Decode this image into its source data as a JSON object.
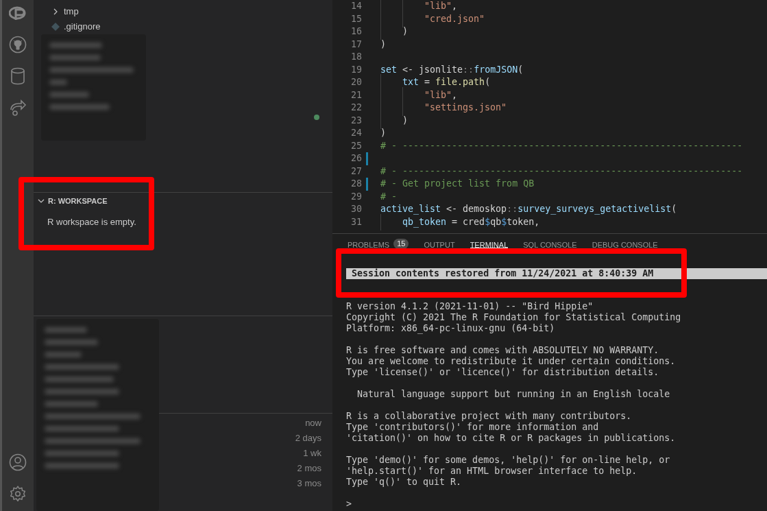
{
  "explorer": {
    "items": [
      {
        "kind": "folder",
        "name": "tmp",
        "expanded": false
      },
      {
        "kind": "file",
        "name": ".gitignore"
      }
    ]
  },
  "workspace": {
    "title": "R: WORKSPACE",
    "expanded": true,
    "message": "R workspace is empty."
  },
  "timeline": {
    "times": [
      "now",
      "2 days",
      "1 wk",
      "2 mos",
      "3 mos"
    ]
  },
  "editor": {
    "lines": [
      {
        "number": "14",
        "modified": false,
        "tokens": [
          {
            "text": "        \"lib\"",
            "kind": "string"
          },
          {
            "text": ",",
            "kind": "plain"
          }
        ]
      },
      {
        "number": "15",
        "modified": false,
        "tokens": [
          {
            "text": "        \"cred.json\"",
            "kind": "string"
          }
        ]
      },
      {
        "number": "16",
        "modified": false,
        "tokens": [
          {
            "text": "    )",
            "kind": "plain"
          }
        ]
      },
      {
        "number": "17",
        "modified": false,
        "tokens": [
          {
            "text": ")",
            "kind": "plain"
          }
        ]
      },
      {
        "number": "18",
        "modified": false
      },
      {
        "number": "19",
        "modified": false,
        "tokens": [
          {
            "text": "set",
            "kind": "var"
          },
          {
            "text": " <- jsonlite",
            "kind": "plain"
          },
          {
            "text": "::",
            "kind": "op"
          },
          {
            "text": "fromJSON",
            "kind": "call"
          },
          {
            "text": "(",
            "kind": "plain"
          }
        ]
      },
      {
        "number": "20",
        "modified": false,
        "tokens": [
          {
            "text": "    txt",
            "kind": "var"
          },
          {
            "text": " = ",
            "kind": "plain"
          },
          {
            "text": "file.path",
            "kind": "func"
          },
          {
            "text": "(",
            "kind": "plain"
          }
        ]
      },
      {
        "number": "21",
        "modified": false,
        "tokens": [
          {
            "text": "        \"lib\"",
            "kind": "string"
          },
          {
            "text": ",",
            "kind": "plain"
          }
        ]
      },
      {
        "number": "22",
        "modified": false,
        "tokens": [
          {
            "text": "        \"settings.json\"",
            "kind": "string"
          }
        ]
      },
      {
        "number": "23",
        "modified": false,
        "tokens": [
          {
            "text": "    )",
            "kind": "plain"
          }
        ]
      },
      {
        "number": "24",
        "modified": false,
        "tokens": [
          {
            "text": ")",
            "kind": "plain"
          }
        ]
      },
      {
        "number": "25",
        "modified": false,
        "tokens": [
          {
            "text": "# - --------------------------------------------------------------",
            "kind": "comment"
          }
        ]
      },
      {
        "number": "26",
        "modified": true
      },
      {
        "number": "27",
        "modified": false,
        "tokens": [
          {
            "text": "# - --------------------------------------------------------------",
            "kind": "comment"
          }
        ]
      },
      {
        "number": "28",
        "modified": true,
        "tokens": [
          {
            "text": "# - Get project list from QB",
            "kind": "comment"
          }
        ]
      },
      {
        "number": "29",
        "modified": false,
        "tokens": [
          {
            "text": "# -",
            "kind": "comment"
          }
        ]
      },
      {
        "number": "30",
        "modified": false,
        "tokens": [
          {
            "text": "active_list",
            "kind": "var"
          },
          {
            "text": " <- demoskop",
            "kind": "plain"
          },
          {
            "text": "::",
            "kind": "op"
          },
          {
            "text": "survey_surveys_getactivelist",
            "kind": "call"
          },
          {
            "text": "(",
            "kind": "plain"
          }
        ]
      },
      {
        "number": "31",
        "modified": false,
        "tokens": [
          {
            "text": "    qb_token",
            "kind": "var"
          },
          {
            "text": " = cred",
            "kind": "plain"
          },
          {
            "text": "$",
            "kind": "dollar"
          },
          {
            "text": "qb",
            "kind": "plain"
          },
          {
            "text": "$",
            "kind": "dollar"
          },
          {
            "text": "token,",
            "kind": "plain"
          }
        ]
      }
    ]
  },
  "panel": {
    "tabs": [
      {
        "label": "PROBLEMS",
        "badge": "15",
        "selected": false
      },
      {
        "label": "OUTPUT",
        "selected": false
      },
      {
        "label": "TERMINAL",
        "selected": true
      },
      {
        "label": "SQL CONSOLE",
        "selected": false
      },
      {
        "label": "DEBUG CONSOLE",
        "selected": false
      }
    ],
    "terminal": {
      "banner": "Session contents restored from 11/24/2021 at 8:40:39 AM",
      "blocks": [
        [
          "R version 4.1.2 (2021-11-01) -- \"Bird Hippie\"",
          "Copyright (C) 2021 The R Foundation for Statistical Computing",
          "Platform: x86_64-pc-linux-gnu (64-bit)"
        ],
        [
          "R is free software and comes with ABSOLUTELY NO WARRANTY.",
          "You are welcome to redistribute it under certain conditions.",
          "Type 'license()' or 'licence()' for distribution details."
        ],
        [
          "  Natural language support but running in an English locale"
        ],
        [
          "R is a collaborative project with many contributors.",
          "Type 'contributors()' for more information and",
          "'citation()' on how to cite R or R packages in publications."
        ],
        [
          "Type 'demo()' for some demos, 'help()' for on-line help, or",
          "'help.start()' for an HTML browser interface to help.",
          "Type 'q()' to quit R."
        ]
      ],
      "prompt": ">"
    }
  }
}
